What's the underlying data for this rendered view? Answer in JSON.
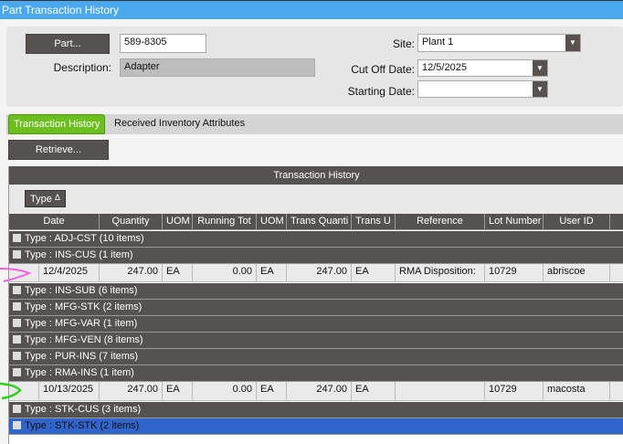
{
  "window": {
    "title": "Part Transaction History"
  },
  "form": {
    "part_button": "Part...",
    "part_value": "589-8305",
    "description_label": "Description:",
    "description_value": "Adapter",
    "site_label": "Site:",
    "site_value": "Plant 1",
    "cutoff_label": "Cut Off Date:",
    "cutoff_value": "12/5/2025",
    "starting_label": "Starting Date:",
    "starting_value": ""
  },
  "tabs": [
    {
      "label": "Transaction History",
      "active": true
    },
    {
      "label": "Received Inventory Attributes"
    }
  ],
  "retrieve_button": "Retrieve...",
  "grid": {
    "title": "Transaction History",
    "group_by_chip": "Type",
    "sort_glyph": "Δ",
    "columns": [
      "Date",
      "Quantity",
      "UOM",
      "Running Tot",
      "UOM",
      "Trans Quanti",
      "Trans U",
      "Reference",
      "Lot Number",
      "User ID"
    ],
    "groups": [
      {
        "label": "Type : ADJ-CST (10 items)"
      },
      {
        "label": "Type : INS-CUS (1 item)",
        "row": {
          "date": "12/4/2025",
          "quantity": "247.00",
          "uom": "EA",
          "running": "0.00",
          "uom2": "EA",
          "trans_qty": "247.00",
          "trans_uom": "EA",
          "reference": "RMA Disposition:",
          "lot": "10729",
          "user": "abriscoe"
        }
      },
      {
        "label": "Type : INS-SUB (6 items)"
      },
      {
        "label": "Type : MFG-STK (2 items)"
      },
      {
        "label": "Type : MFG-VAR (1 item)"
      },
      {
        "label": "Type : MFG-VEN (8 items)"
      },
      {
        "label": "Type : PUR-INS (7 items)"
      },
      {
        "label": "Type : RMA-INS (1 item)",
        "row": {
          "date": "10/13/2025",
          "quantity": "247.00",
          "uom": "EA",
          "running": "0.00",
          "uom2": "EA",
          "trans_qty": "247.00",
          "trans_uom": "EA",
          "reference": "",
          "lot": "10729",
          "user": "macosta"
        }
      },
      {
        "label": "Type : STK-CUS (3 items)"
      },
      {
        "label": "Type : STK-STK (2 items)",
        "selected": true
      }
    ]
  },
  "colors": {
    "title": "#4aa9ee",
    "tab_active": "#6cbf1f",
    "selected": "#3265cc",
    "dark": "#555250",
    "pink_arrow": "#f060e0",
    "green_arrow": "#30d020"
  }
}
